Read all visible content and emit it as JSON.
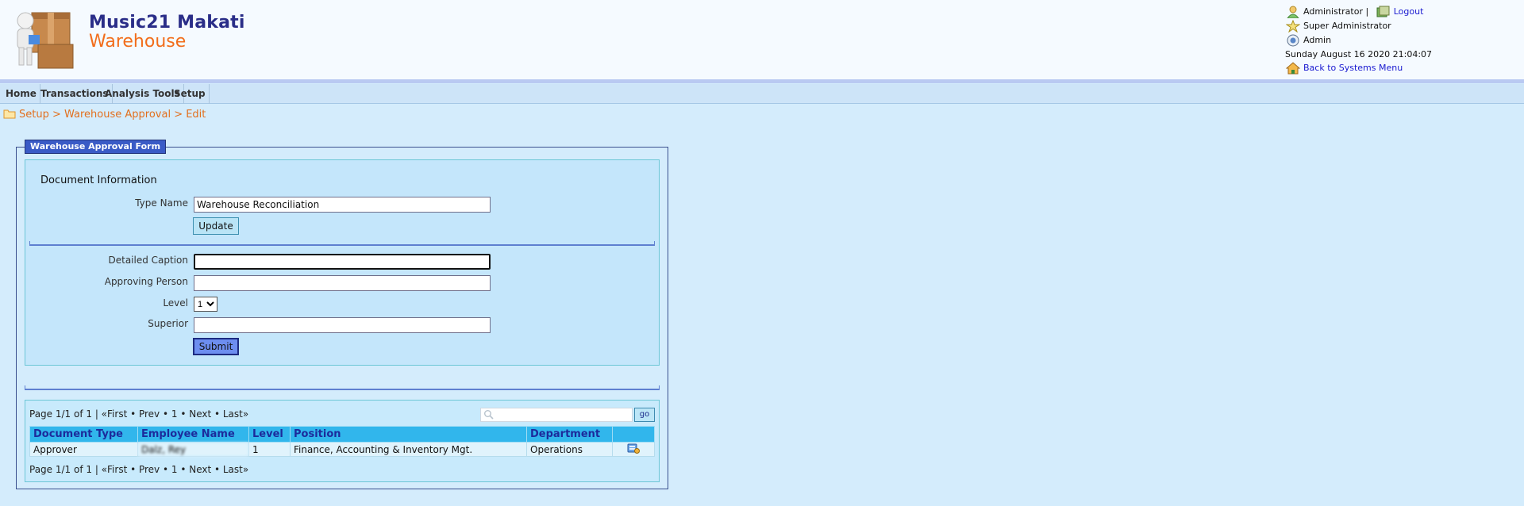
{
  "brand": {
    "line1": "Music21 Makati",
    "line2": "Warehouse"
  },
  "user": {
    "name": "Administrator",
    "separator": "|",
    "logout": "Logout",
    "role": "Super Administrator",
    "group": "Admin",
    "datetime": "Sunday August 16 2020 21:04:07",
    "back_link": "Back to Systems Menu"
  },
  "menu": [
    "Home",
    "Transactions",
    "Analysis Tools",
    "Setup"
  ],
  "breadcrumb": "Setup > Warehouse Approval > Edit",
  "form": {
    "legend": "Warehouse Approval Form",
    "section_title": "Document Information",
    "type_name_label": "Type Name",
    "type_name_value": "Warehouse Reconciliation",
    "update_label": "Update",
    "detailed_caption_label": "Detailed Caption",
    "approving_person_label": "Approving Person",
    "level_label": "Level",
    "level_value": "1",
    "superior_label": "Superior",
    "submit_label": "Submit"
  },
  "grid": {
    "pager_text": "Page 1/1 of 1 | «First • Prev • 1 • Next • Last»",
    "go_label": "go",
    "columns": [
      "Document Type",
      "Employee Name",
      "Level",
      "Position",
      "Department"
    ],
    "rows": [
      {
        "document_type": "Approver",
        "employee_name": "Dalz, Rey",
        "level": "1",
        "position": "Finance, Accounting & Inventory Mgt.",
        "department": "Operations"
      }
    ]
  },
  "icons": {
    "user": "user-icon",
    "logout": "logout-icon",
    "role": "star-icon",
    "group": "group-icon",
    "back": "home-icon",
    "breadcrumb": "folder-icon",
    "search": "search-icon",
    "row_action": "edit-record-icon"
  }
}
